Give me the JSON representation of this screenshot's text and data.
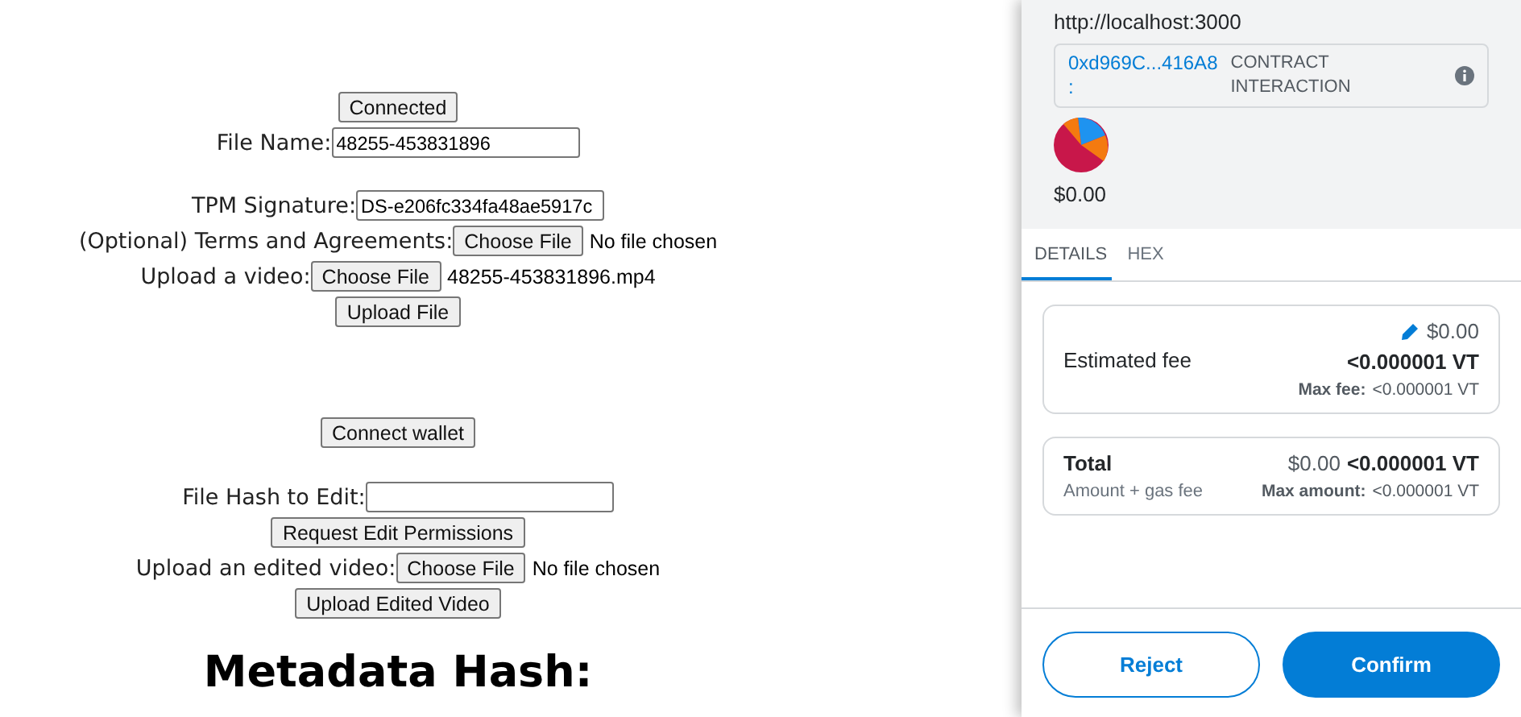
{
  "form": {
    "sections": [
      {
        "rows": [
          {
            "kind": "button",
            "label": "Connected"
          },
          {
            "kind": "text_field",
            "label": "File Name:",
            "value": "48255-453831896"
          }
        ]
      },
      {
        "rows": [
          {
            "kind": "text_field",
            "label": "TPM Signature: ",
            "value": "DS-e206fc334fa48ae5917c"
          },
          {
            "kind": "file_input",
            "label": "(Optional) Terms and Agreements:",
            "button": "Choose File",
            "file": "No file chosen"
          },
          {
            "kind": "file_input",
            "label": "Upload a video:",
            "button": "Choose File",
            "file": "48255-453831896.mp4"
          },
          {
            "kind": "button",
            "label": "Upload File"
          }
        ]
      },
      {
        "rows": [
          {
            "kind": "button",
            "label": "Connect wallet"
          }
        ]
      },
      {
        "rows": [
          {
            "kind": "text_field",
            "label": "File Hash to Edit:",
            "value": ""
          },
          {
            "kind": "button",
            "label": "Request Edit Permissions"
          },
          {
            "kind": "file_input",
            "label": "Upload an edited video:",
            "button": "Choose File",
            "file": "No file chosen"
          },
          {
            "kind": "button",
            "label": "Upload Edited Video"
          }
        ]
      },
      {
        "rows": [
          {
            "kind": "heading",
            "label": "Metadata Hash:"
          }
        ]
      }
    ]
  },
  "popup": {
    "origin": "http://localhost:3000",
    "address": "0xd969C...416A8",
    "address_suffix": ":",
    "interaction": "CONTRACT\nINTERACTION",
    "amount": "$0.00",
    "tabs": [
      {
        "label": "DETAILS",
        "selected": true
      },
      {
        "label": "HEX",
        "selected": false
      }
    ],
    "fee": {
      "label": "Estimated fee",
      "fiat": "$0.00",
      "crypto": "<0.000001 VT",
      "max_label": "Max fee:",
      "max_value": "<0.000001 VT"
    },
    "total": {
      "label": "Total",
      "fiat": "$0.00",
      "crypto": "<0.000001 VT",
      "sublabel": "Amount + gas fee",
      "max_label": "Max amount:",
      "max_value": "<0.000001 VT"
    },
    "buttons": [
      {
        "kind": "secondary",
        "label": "Reject"
      },
      {
        "kind": "primary",
        "label": "Confirm"
      }
    ]
  }
}
